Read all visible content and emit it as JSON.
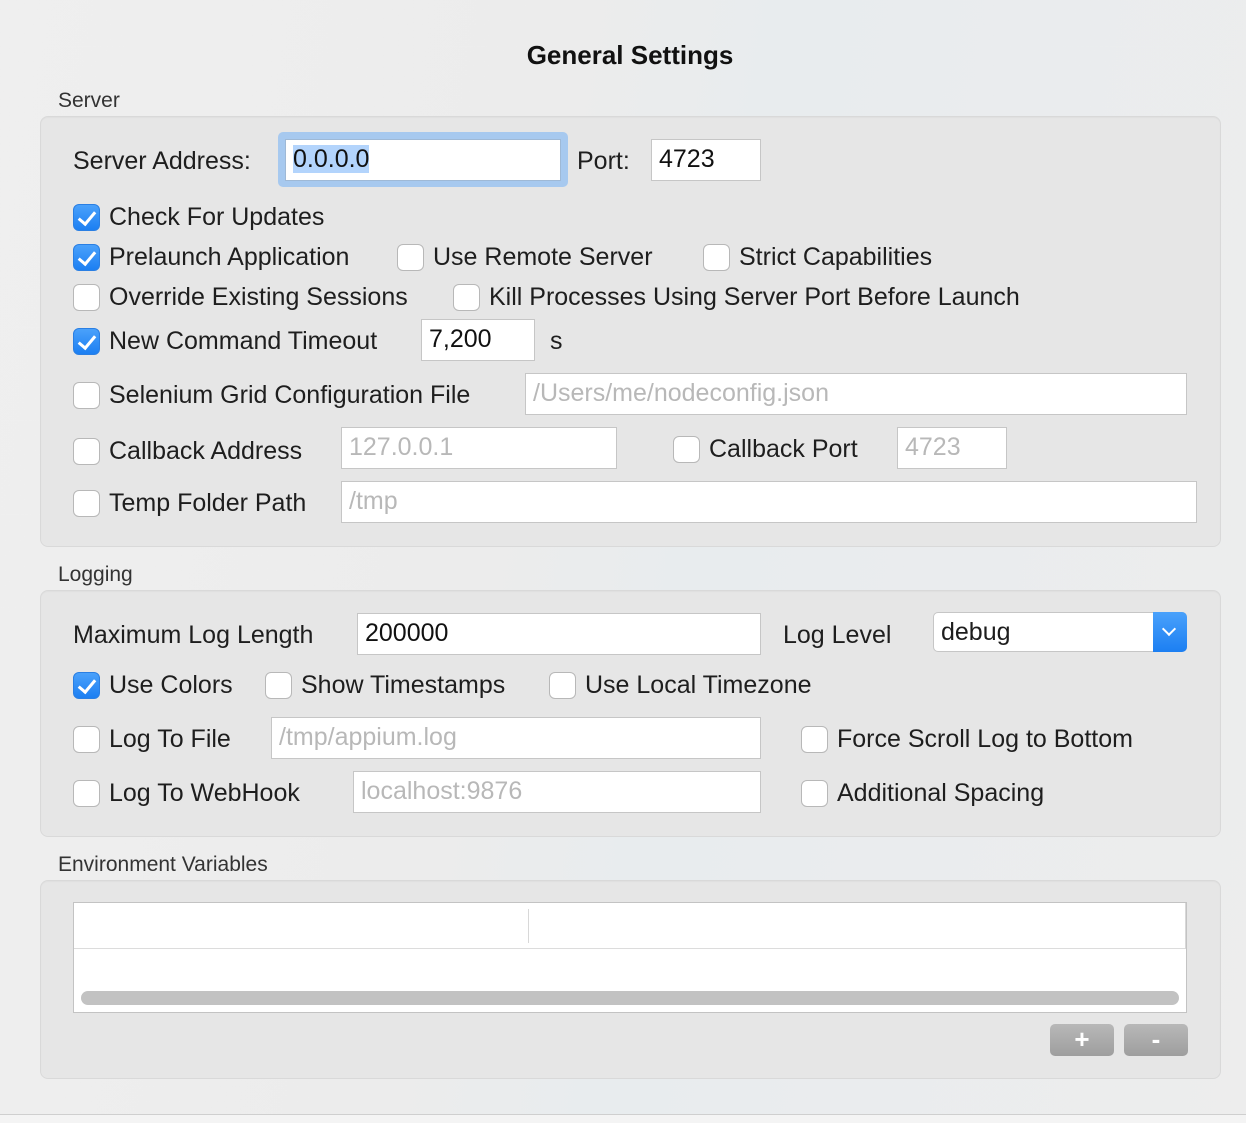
{
  "window": {
    "title": "General Settings"
  },
  "server": {
    "section_label": "Server",
    "address_label": "Server Address:",
    "address_value": "0.0.0.0",
    "port_label": "Port:",
    "port_value": "4723",
    "check_updates": {
      "label": "Check For Updates",
      "checked": true
    },
    "prelaunch": {
      "label": "Prelaunch Application",
      "checked": true
    },
    "remote_server": {
      "label": "Use Remote Server",
      "checked": false
    },
    "strict_caps": {
      "label": "Strict Capabilities",
      "checked": false
    },
    "override_sessions": {
      "label": "Override Existing Sessions",
      "checked": false
    },
    "kill_processes": {
      "label": "Kill Processes Using Server Port Before Launch",
      "checked": false
    },
    "new_cmd_timeout": {
      "label": "New Command Timeout",
      "checked": true,
      "value": "7,200",
      "unit": "s"
    },
    "selenium_grid": {
      "label": "Selenium Grid Configuration File",
      "checked": false,
      "placeholder": "/Users/me/nodeconfig.json"
    },
    "callback_address": {
      "label": "Callback Address",
      "checked": false,
      "placeholder": "127.0.0.1"
    },
    "callback_port": {
      "label": "Callback Port",
      "checked": false,
      "placeholder": "4723"
    },
    "temp_folder": {
      "label": "Temp Folder Path",
      "checked": false,
      "placeholder": "/tmp"
    }
  },
  "logging": {
    "section_label": "Logging",
    "max_log_label": "Maximum Log Length",
    "max_log_value": "200000",
    "log_level_label": "Log Level",
    "log_level_value": "debug",
    "use_colors": {
      "label": "Use Colors",
      "checked": true
    },
    "show_timestamps": {
      "label": "Show Timestamps",
      "checked": false
    },
    "local_timezone": {
      "label": "Use Local Timezone",
      "checked": false
    },
    "log_to_file": {
      "label": "Log To File",
      "checked": false,
      "placeholder": "/tmp/appium.log"
    },
    "force_scroll": {
      "label": "Force Scroll Log to Bottom",
      "checked": false
    },
    "log_to_webhook": {
      "label": "Log To WebHook",
      "checked": false,
      "placeholder": "localhost:9876"
    },
    "additional_spacing": {
      "label": "Additional Spacing",
      "checked": false
    }
  },
  "env": {
    "section_label": "Environment Variables",
    "add_label": "+",
    "remove_label": "-"
  }
}
